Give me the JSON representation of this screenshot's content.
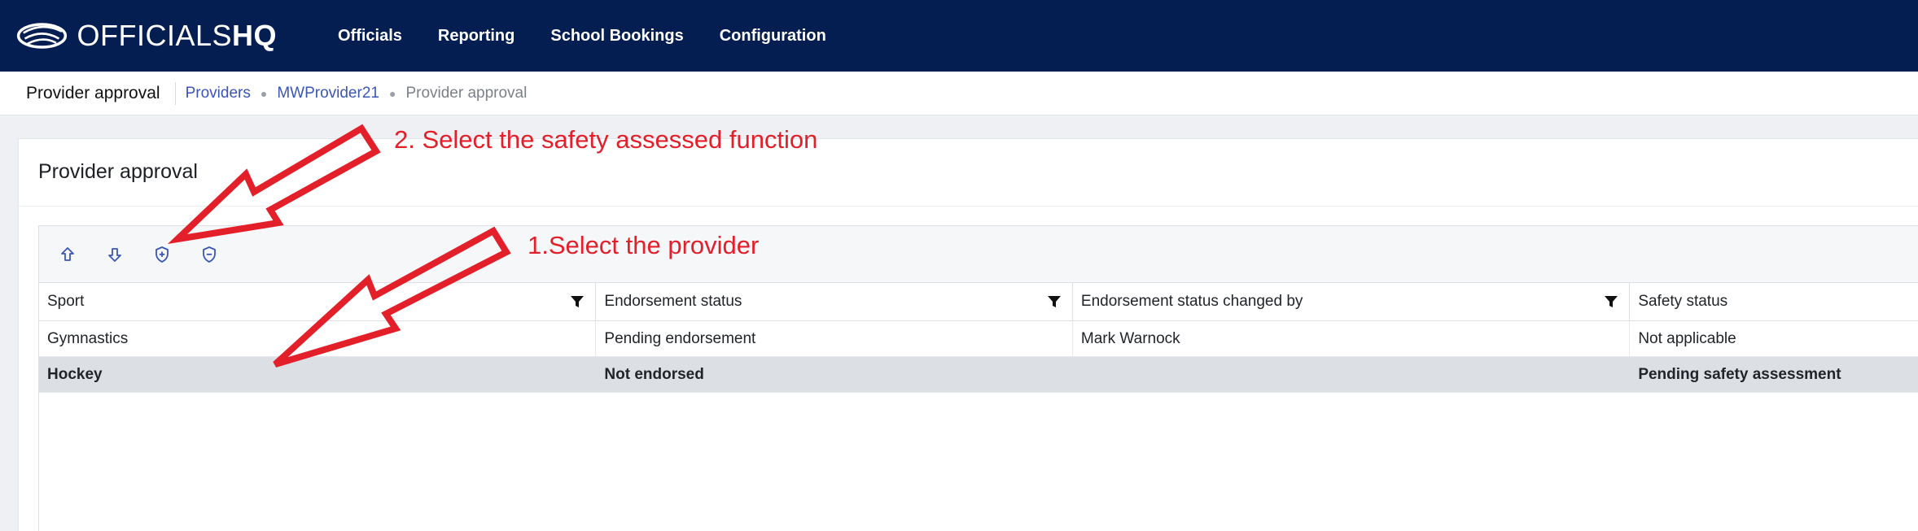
{
  "app": {
    "logo_light": "OFFICIALS",
    "logo_bold": "HQ"
  },
  "nav": {
    "items": [
      "Officials",
      "Reporting",
      "School Bookings",
      "Configuration"
    ]
  },
  "breadcrumb": {
    "page_title": "Provider approval",
    "links": [
      "Providers",
      "MWProvider21"
    ],
    "current": "Provider approval"
  },
  "card": {
    "title": "Provider approval"
  },
  "toolbar": {
    "icons": [
      "arrow-up-icon",
      "arrow-down-icon",
      "shield-plus-icon",
      "shield-minus-icon"
    ]
  },
  "table": {
    "columns": [
      "Sport",
      "Endorsement status",
      "Endorsement status changed by",
      "Safety status"
    ],
    "rows": [
      [
        "Gymnastics",
        "Pending endorsement",
        "Mark Warnock",
        "Not applicable"
      ],
      [
        "Hockey",
        "Not endorsed",
        "",
        "Pending safety assessment"
      ]
    ],
    "selected_row": 1
  },
  "annotations": {
    "step2": "2. Select the safety assessed function",
    "step1": "1.Select the provider",
    "color": "#e3202a"
  },
  "colors": {
    "nav_bg": "#041e52",
    "link": "#3b56b5",
    "selected_row_bg": "#dcdfe4"
  }
}
